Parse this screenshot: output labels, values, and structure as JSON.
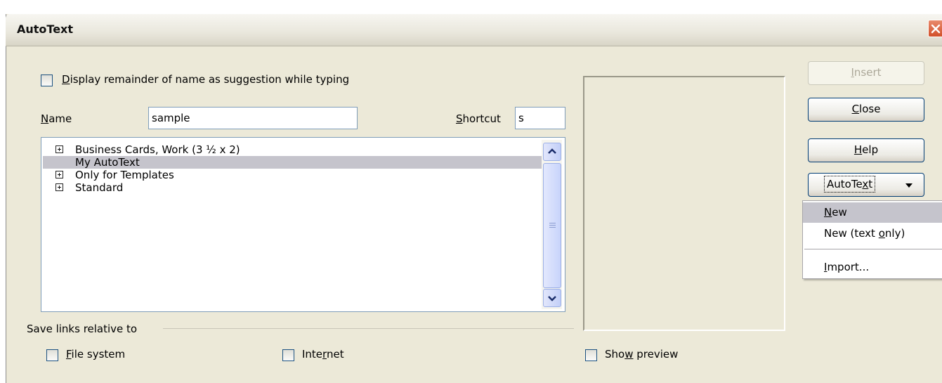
{
  "dialog": {
    "title": "AutoText"
  },
  "options": {
    "display_remainder": {
      "pre": "",
      "mnemonic": "D",
      "post": "isplay remainder of name as suggestion while typing",
      "checked": false
    }
  },
  "name_field": {
    "label_pre": "",
    "label_mnemonic": "N",
    "label_post": "ame",
    "value": "sample"
  },
  "shortcut_field": {
    "label_pre": "",
    "label_mnemonic": "S",
    "label_post": "hortcut",
    "value": "s"
  },
  "tree": {
    "items": [
      {
        "label": "Business Cards, Work (3 ½ x 2)",
        "expandable": true,
        "selected": false
      },
      {
        "label": "My AutoText",
        "expandable": false,
        "selected": true
      },
      {
        "label": "Only for Templates",
        "expandable": true,
        "selected": false
      },
      {
        "label": "Standard",
        "expandable": true,
        "selected": false
      }
    ]
  },
  "save_links": {
    "group_label": "Save links relative to",
    "file_system": {
      "pre": "",
      "mnemonic": "F",
      "post": "ile system",
      "checked": false
    },
    "internet": {
      "pre": "Inte",
      "mnemonic": "r",
      "post": "net",
      "checked": false
    }
  },
  "show_preview": {
    "pre": "Sho",
    "mnemonic": "w",
    "post": " preview",
    "checked": false
  },
  "buttons": {
    "insert": {
      "pre": "",
      "mnemonic": "I",
      "post": "nsert",
      "enabled": false
    },
    "close": {
      "pre": "",
      "mnemonic": "C",
      "post": "lose"
    },
    "help": {
      "pre": "",
      "mnemonic": "H",
      "post": "elp"
    },
    "autotext": {
      "pre": "AutoTe",
      "mnemonic": "x",
      "post": "t"
    }
  },
  "autotext_menu": {
    "items": [
      {
        "pre": "",
        "mnemonic": "N",
        "post": "ew",
        "highlighted": true
      },
      {
        "pre": "New (text ",
        "mnemonic": "o",
        "post": "nly)",
        "highlighted": false
      },
      {
        "pre": "",
        "mnemonic": "I",
        "post": "mport...",
        "highlighted": false
      }
    ]
  },
  "colors": {
    "dialog_bg": "#ece9d8",
    "selection": "#c5c4cc",
    "close_button": "#d2502a"
  }
}
